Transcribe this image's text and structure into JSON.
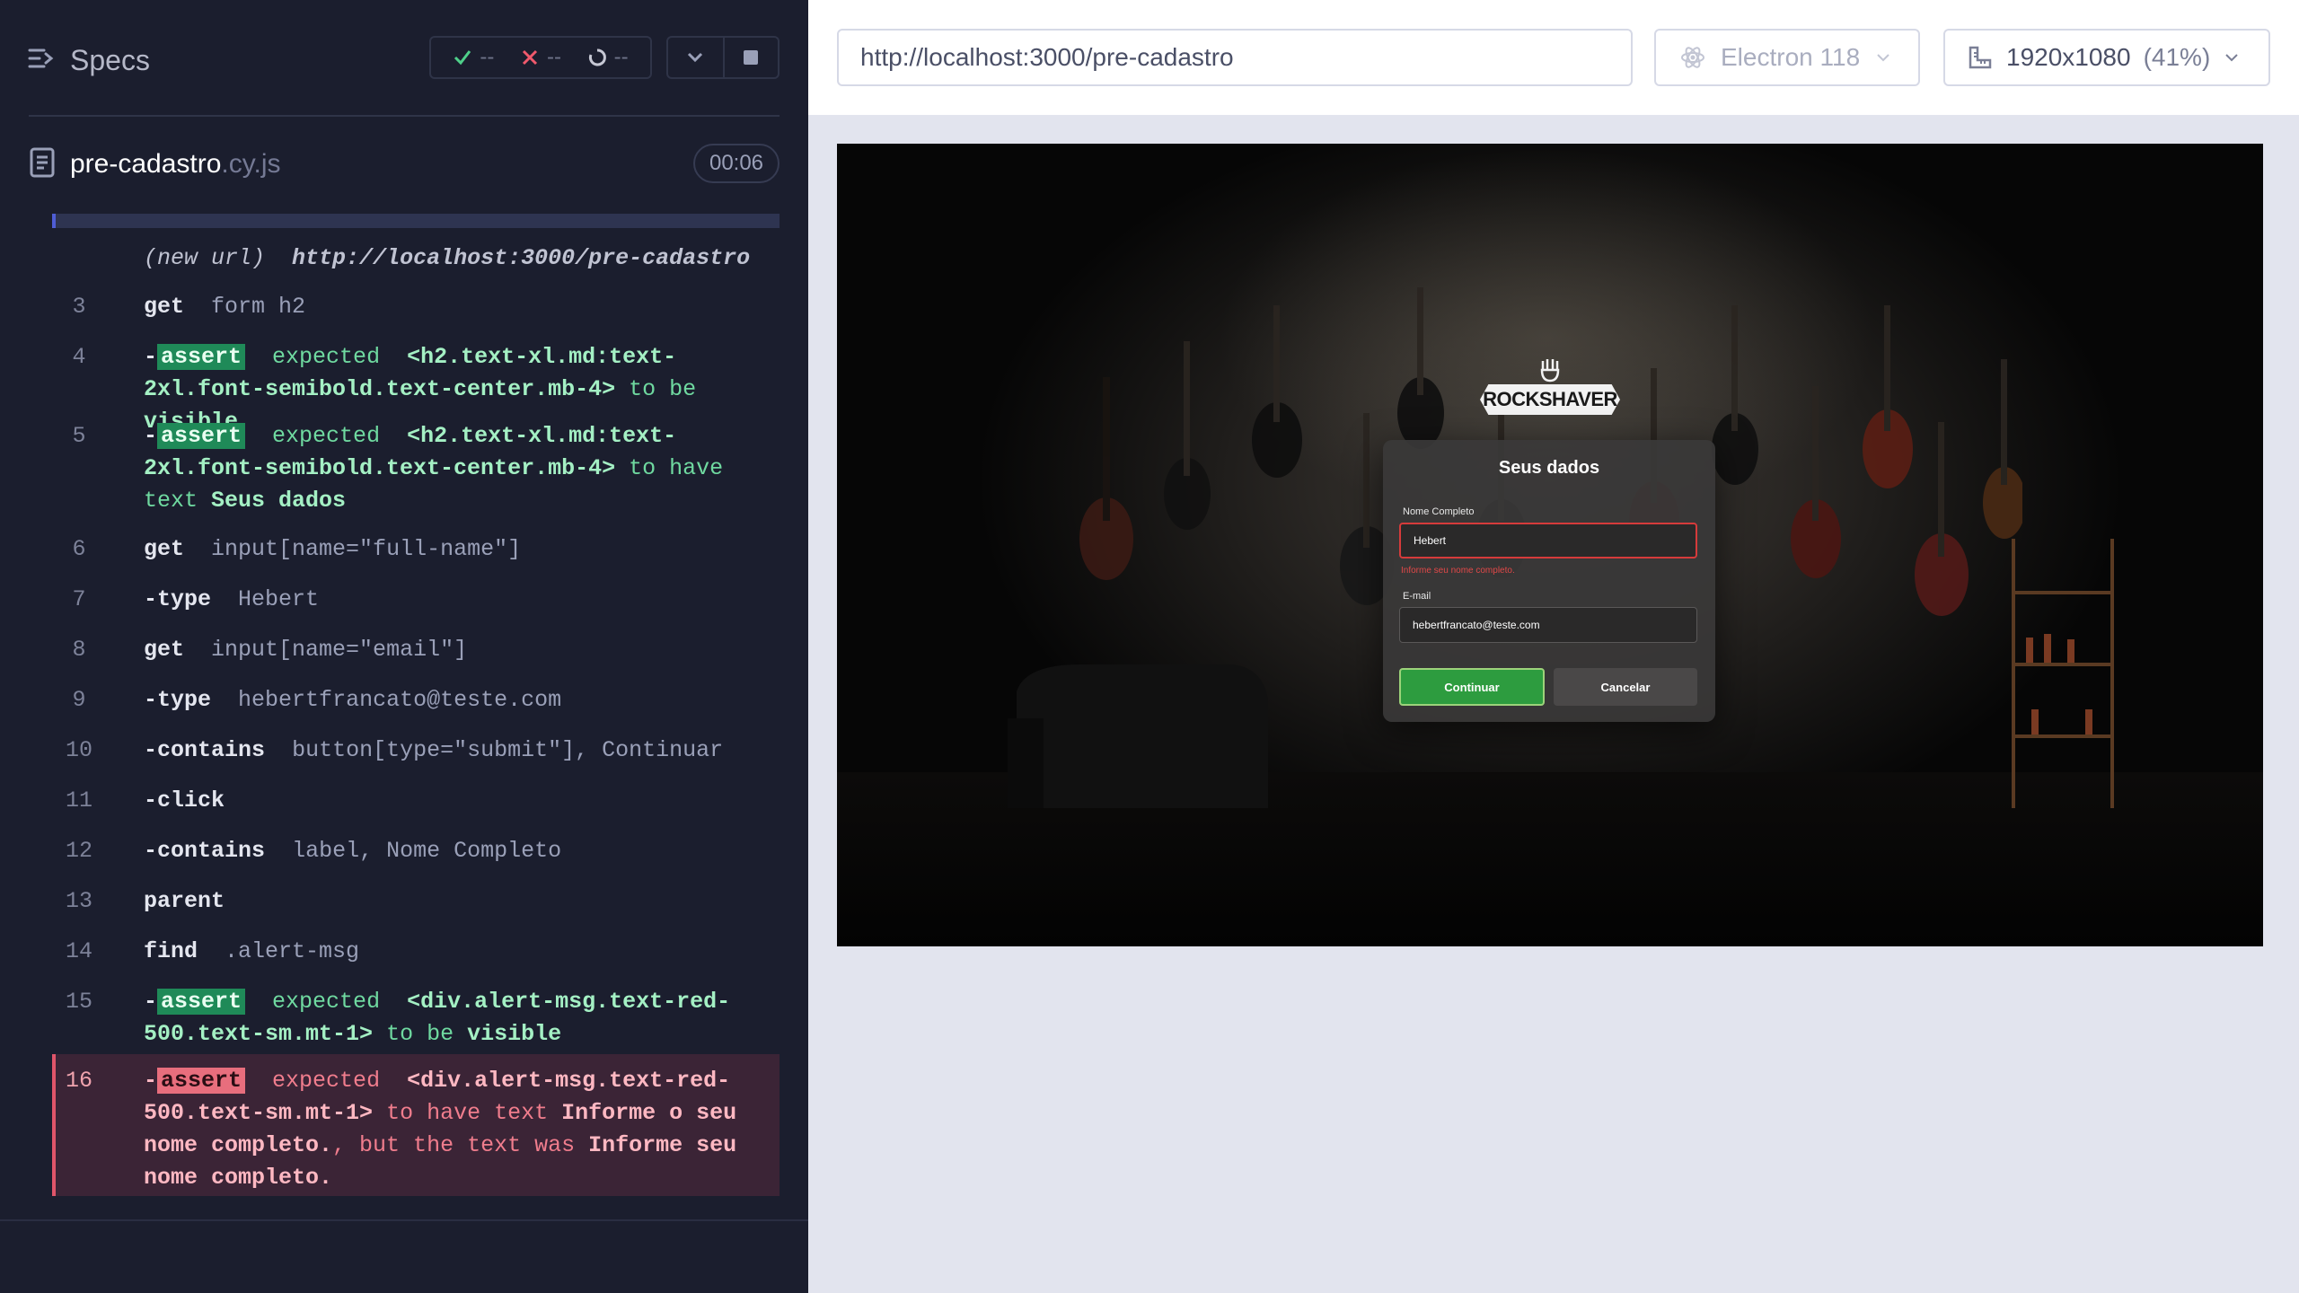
{
  "reporter": {
    "specs_label": "Specs",
    "stats": {
      "passed": "--",
      "failed": "--",
      "pending": "--"
    },
    "spec_file": {
      "name": "pre-cadastro",
      "ext": ".cy.js"
    },
    "duration": "00:06",
    "commands": [
      {
        "num": "",
        "url_label": "(new url)",
        "url": "http://localhost:3000/pre-cadastro"
      },
      {
        "num": "3",
        "cmd": "get",
        "arg": "form h2"
      },
      {
        "num": "4",
        "tag": "assert",
        "text1": "expected",
        "subject": "<h2.text-xl.md:text-2xl.font-semibold.text-center.mb-4>",
        "text2": "to be",
        "value": "visible"
      },
      {
        "num": "5",
        "tag": "assert",
        "text1": "expected",
        "subject": "<h2.text-xl.md:text-2xl.font-semibold.text-center.mb-4>",
        "text2": "to have text",
        "value": "Seus dados"
      },
      {
        "num": "6",
        "cmd": "get",
        "arg": "input[name=\"full-name\"]"
      },
      {
        "num": "7",
        "cmd": "type",
        "arg": "Hebert"
      },
      {
        "num": "8",
        "cmd": "get",
        "arg": "input[name=\"email\"]"
      },
      {
        "num": "9",
        "cmd": "type",
        "arg": "hebertfrancato@teste.com"
      },
      {
        "num": "10",
        "cmd": "contains",
        "arg": "button[type=\"submit\"], Continuar"
      },
      {
        "num": "11",
        "cmd": "click",
        "arg": ""
      },
      {
        "num": "12",
        "cmd": "contains",
        "arg": "label, Nome Completo"
      },
      {
        "num": "13",
        "cmd": "parent",
        "arg": ""
      },
      {
        "num": "14",
        "cmd": "find",
        "arg": ".alert-msg"
      },
      {
        "num": "15",
        "tag": "assert",
        "text1": "expected",
        "subject": "<div.alert-msg.text-red-500.text-sm.mt-1>",
        "text2": "to be",
        "value": "visible"
      },
      {
        "num": "16",
        "tag": "assert",
        "text1": "expected",
        "subject": "<div.alert-msg.text-red-500.text-sm.mt-1>",
        "text2": "to have text",
        "value": "Informe o seu nome completo.",
        "text3": ", but the text was",
        "value2": "Informe seu nome completo."
      }
    ]
  },
  "toolbar": {
    "url": "http://localhost:3000/pre-cadastro",
    "browser": "Electron 118",
    "viewport": "1920x1080",
    "viewport_pct": "(41%)"
  },
  "app": {
    "brand": "ROCKSHAVER",
    "form_title": "Seus dados",
    "name_label": "Nome Completo",
    "name_value": "Hebert",
    "name_alert": "Informe seu nome completo.",
    "email_label": "E-mail",
    "email_value": "hebertfrancato@teste.com",
    "continue_label": "Continuar",
    "cancel_label": "Cancelar"
  },
  "colors": {
    "reporter_bg": "#1b1e2e",
    "pass": "#1f8a58",
    "fail": "#e86e7d",
    "accent": "#4f5dd5",
    "app_primary": "#2d9c3f",
    "app_error": "#d63b3b"
  }
}
